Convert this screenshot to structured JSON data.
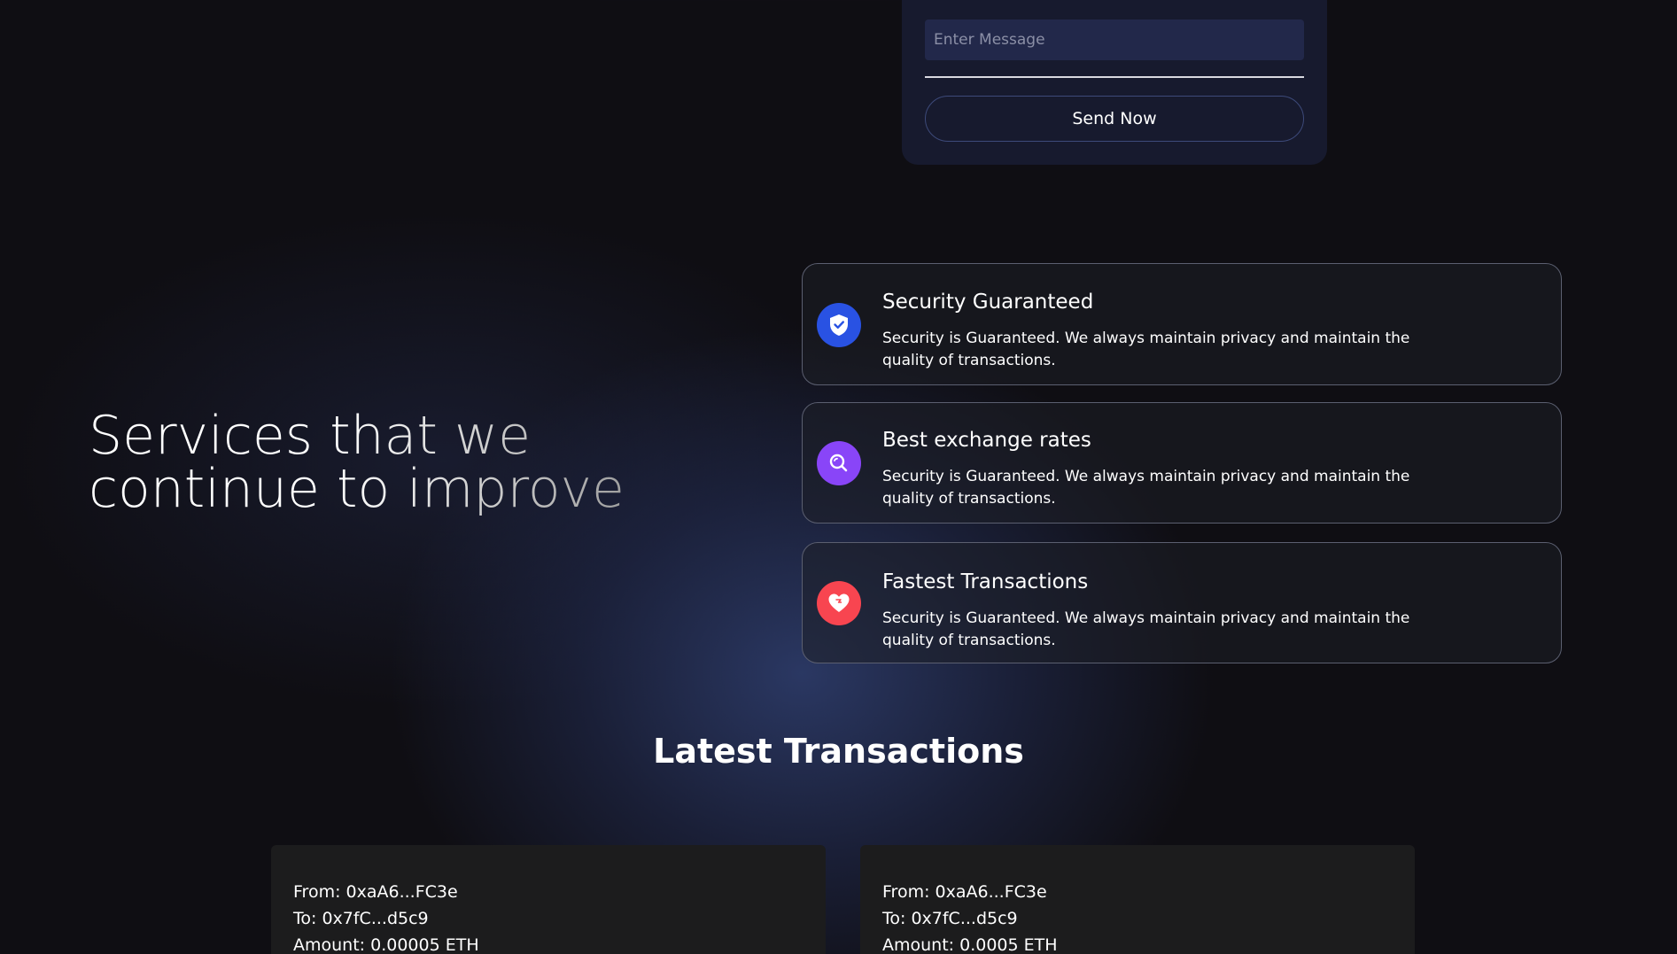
{
  "contact_form": {
    "message_placeholder": "Enter Message",
    "send_button_label": "Send Now"
  },
  "services": {
    "heading_line1": "Services that we",
    "heading_line2": "continue to improve",
    "items": [
      {
        "title": "Security Guaranteed",
        "description": "Security is Guaranteed. We always maintain privacy and maintain the quality of transactions.",
        "icon": "shield-check-icon",
        "icon_color": "#2952e3"
      },
      {
        "title": "Best exchange rates",
        "description": "Security is Guaranteed. We always maintain privacy and maintain the quality of transactions.",
        "icon": "search-icon",
        "icon_color": "#8945f8"
      },
      {
        "title": "Fastest Transactions",
        "description": "Security is Guaranteed. We always maintain privacy and maintain the quality of transactions.",
        "icon": "heart-icon",
        "icon_color": "#f84550"
      }
    ]
  },
  "transactions": {
    "title": "Latest Transactions",
    "items": [
      {
        "from": "From: 0xaA6...FC3e",
        "to": "To: 0x7fC...d5c9",
        "amount": "Amount: 0.00005 ETH"
      },
      {
        "from": "From: 0xaA6...FC3e",
        "to": "To: 0x7fC...d5c9",
        "amount": "Amount: 0.0005 ETH"
      }
    ]
  }
}
